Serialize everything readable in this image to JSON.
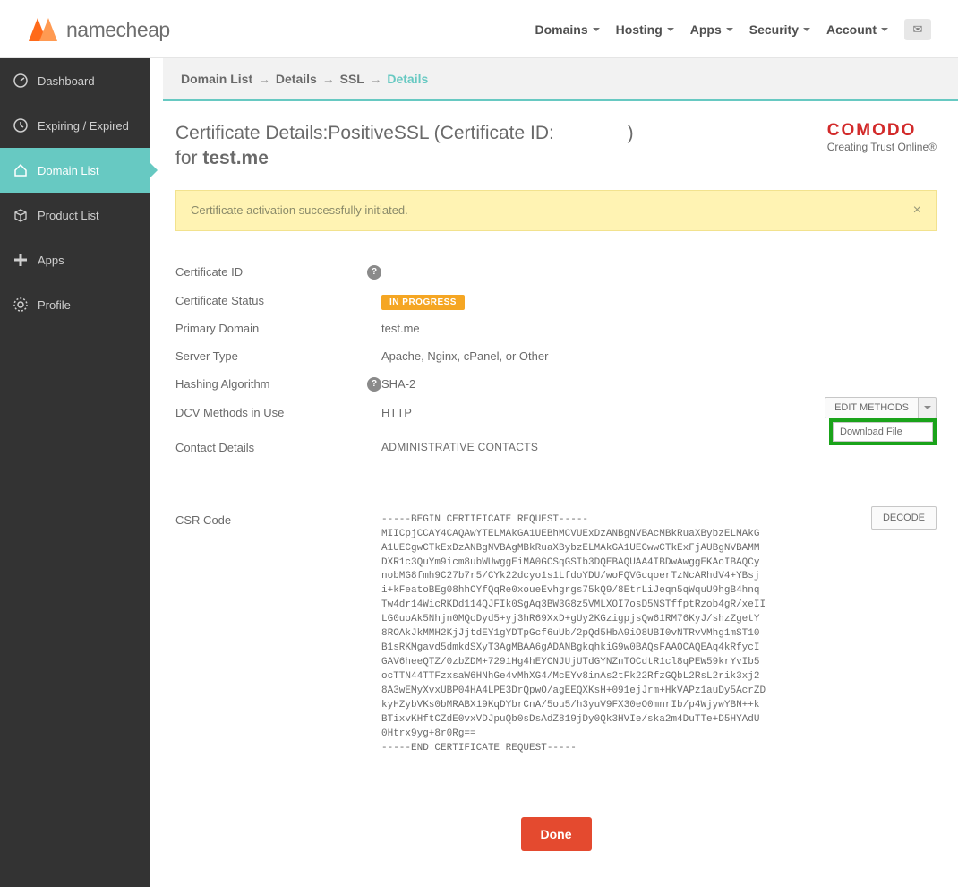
{
  "header": {
    "brand": "namecheap",
    "nav": [
      "Domains",
      "Hosting",
      "Apps",
      "Security",
      "Account"
    ]
  },
  "sidebar": {
    "items": [
      {
        "label": "Dashboard",
        "icon": "gauge"
      },
      {
        "label": "Expiring / Expired",
        "icon": "clock"
      },
      {
        "label": "Domain List",
        "icon": "home",
        "active": true
      },
      {
        "label": "Product List",
        "icon": "box"
      },
      {
        "label": "Apps",
        "icon": "plus"
      },
      {
        "label": "Profile",
        "icon": "gear"
      }
    ]
  },
  "breadcrumb": {
    "parts": [
      "Domain List",
      "Details",
      "SSL"
    ],
    "current": "Details"
  },
  "title": {
    "line1_a": "Certificate Details:",
    "line1_b": "PositiveSSL (Certificate ID:",
    "line1_c": ")",
    "line2_prefix": "for ",
    "domain": "test.me"
  },
  "vendor": {
    "brand": "COMODO",
    "tag": "Creating Trust Online®"
  },
  "alert": {
    "text": "Certificate activation successfully initiated."
  },
  "fields": {
    "cert_id_label": "Certificate ID",
    "cert_id_value": "",
    "status_label": "Certificate Status",
    "status_value": "IN PROGRESS",
    "primary_domain_label": "Primary Domain",
    "primary_domain_value": "test.me",
    "server_type_label": "Server Type",
    "server_type_value": "Apache, Nginx, cPanel, or Other",
    "hash_label": "Hashing Algorithm",
    "hash_value": "SHA-2",
    "dcv_label": "DCV Methods in Use",
    "dcv_value": "HTTP",
    "contact_label": "Contact Details",
    "contact_header": "ADMINISTRATIVE CONTACTS",
    "csr_label": "CSR Code"
  },
  "buttons": {
    "edit_methods": "EDIT METHODS",
    "download_file": "Download File",
    "decode": "DECODE",
    "done": "Done"
  },
  "csr": "-----BEGIN CERTIFICATE REQUEST-----\nMIICpjCCAY4CAQAwYTELMAkGA1UEBhMCVUExDzANBgNVBAcMBkRuaXBybzELMAkG\nA1UECgwCTkExDzANBgNVBAgMBkRuaXBybzELMAkGA1UECwwCTkExFjAUBgNVBAMM\nDXR1c3QuYm9icm8ubWUwggEiMA0GCSqGSIb3DQEBAQUAA4IBDwAwggEKAoIBAQCy\nnobMG8fmh9C27b7r5/CYk22dcyo1s1LfdoYDU/woFQVGcqoerTzNcARhdV4+YBsj\ni+kFeatoBEg08hhCYfQqRe0xoueEvhgrgs75kQ9/8EtrLiJeqn5qWquU9hgB4hnq\nTw4dr14WicRKDd114QJFIk0SgAq3BW3G8z5VMLXOI7osD5NSTffptRzob4gR/xeII\nLG0uoAk5Nhjn0MQcDyd5+yj3hR69XxD+gUy2KGzigpjsQw61RM76KyJ/shzZgetY\n8ROAkJkMMH2KjJjtdEY1gYDTpGcf6uUb/2pQd5HbA9iO8UBI0vNTRvVMhg1mST10\nB1sRKMgavd5dmkdSXyT3AgMBAA6gADANBgkqhkiG9w0BAQsFAAOCAQEAq4kRfycI\nGAV6heeQTZ/0zbZDM+7291Hg4hEYCNJUjUTdGYNZnTOCdtR1cl8qPEW59krYvIb5\nocTTN44TTFzxsaW6HNhGe4vMhXG4/McEYv8inAs2tFk22RfzGQbL2RsL2rik3xj2\n8A3wEMyXvxUBP04HA4LPE3DrQpwO/agEEQXKsH+091ejJrm+HkVAPz1auDy5AcrZD\nkyHZybVKs0bMRABX19KqDYbrCnA/5ou5/h3yuV9FX30eO0mnrIb/p4WjywYBN++k\nBTixvKHftCZdE0vxVDJpuQb0sDsAdZ819jDy0Qk3HVIe/ska2m4DuTTe+D5HYAdU\n0Htrx9yg+8r0Rg==\n-----END CERTIFICATE REQUEST-----"
}
